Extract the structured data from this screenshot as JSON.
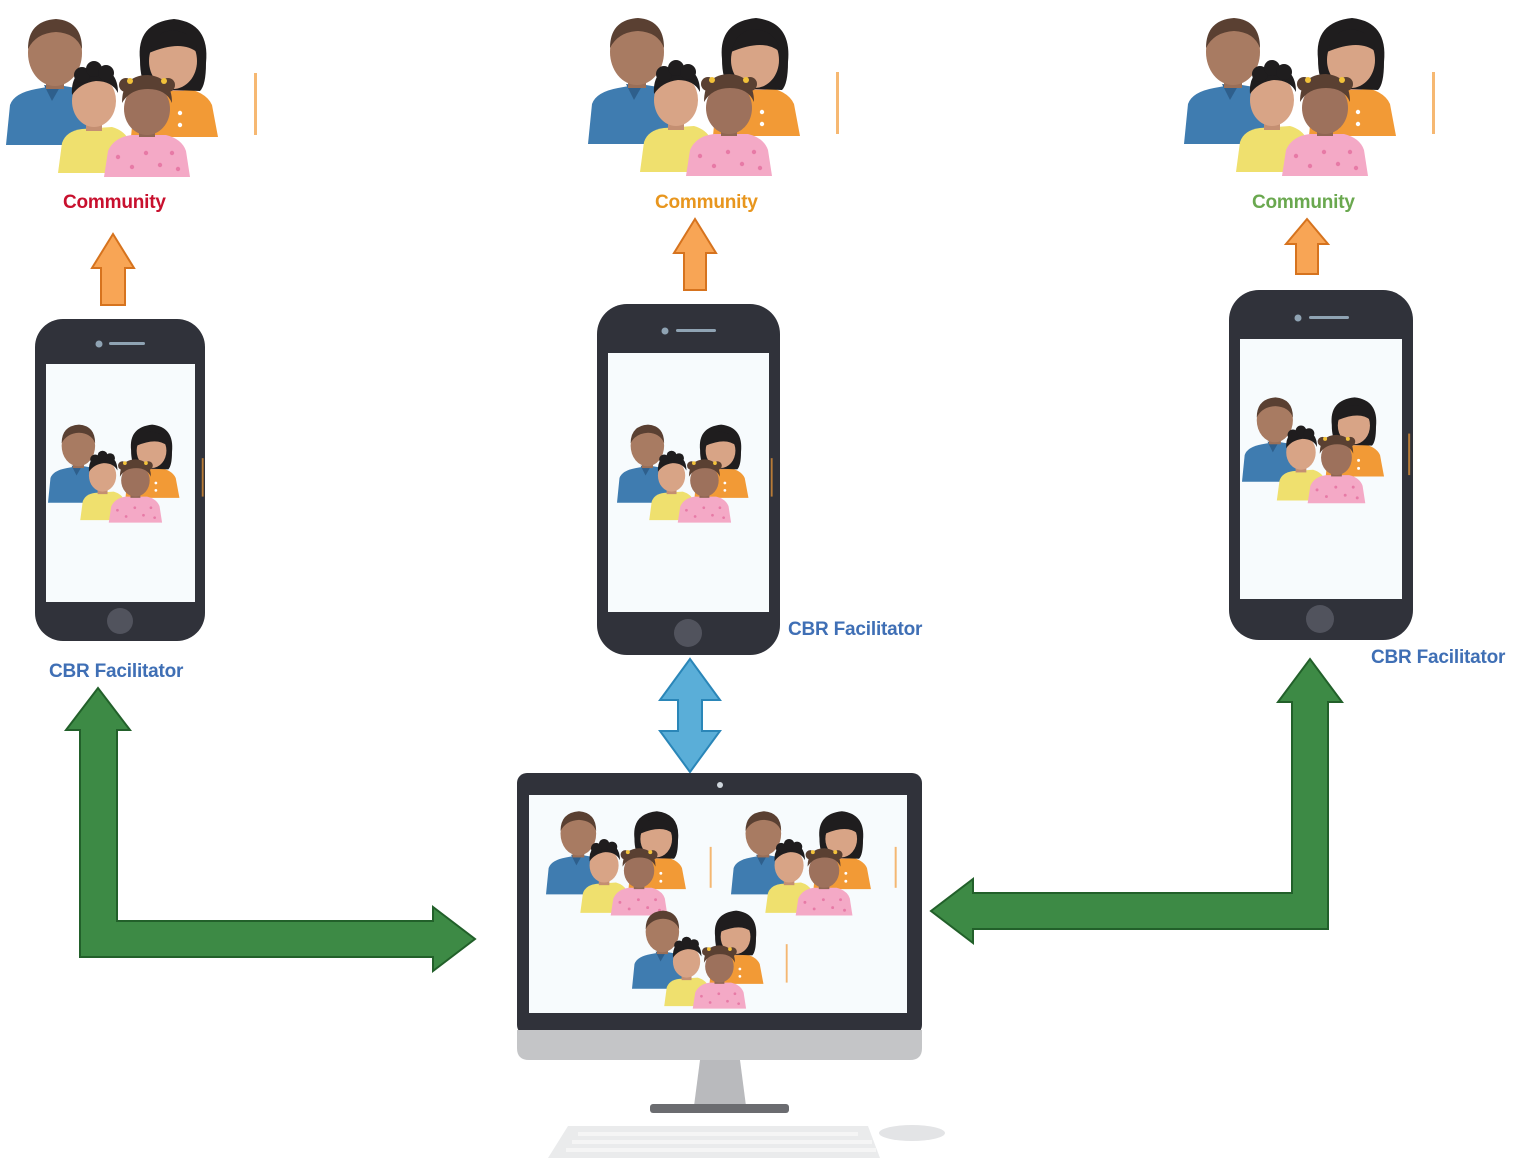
{
  "labels": {
    "community_left": "Community",
    "community_middle": "Community",
    "community_right": "Community",
    "facilitator_left": "CBR Facilitator",
    "facilitator_middle": "CBR Facilitator",
    "facilitator_right": "CBR Facilitator"
  },
  "colors": {
    "community_left": "#c8102e",
    "community_middle": "#e8961e",
    "community_right": "#6aa84f",
    "facilitator": "#3f6fb5",
    "green_arrow": "#3d8a45",
    "green_arrow_stroke": "#22602a",
    "orange_arrow": "#f8a555",
    "orange_arrow_stroke": "#d6731e",
    "blue_arrow": "#5aaed8",
    "blue_arrow_stroke": "#2a86b8",
    "device_frame": "#30323a",
    "screen": "#f7fbfd"
  },
  "icons": [
    "family-icon",
    "phone-icon",
    "desktop-icon",
    "keyboard-icon",
    "mouse-icon"
  ]
}
